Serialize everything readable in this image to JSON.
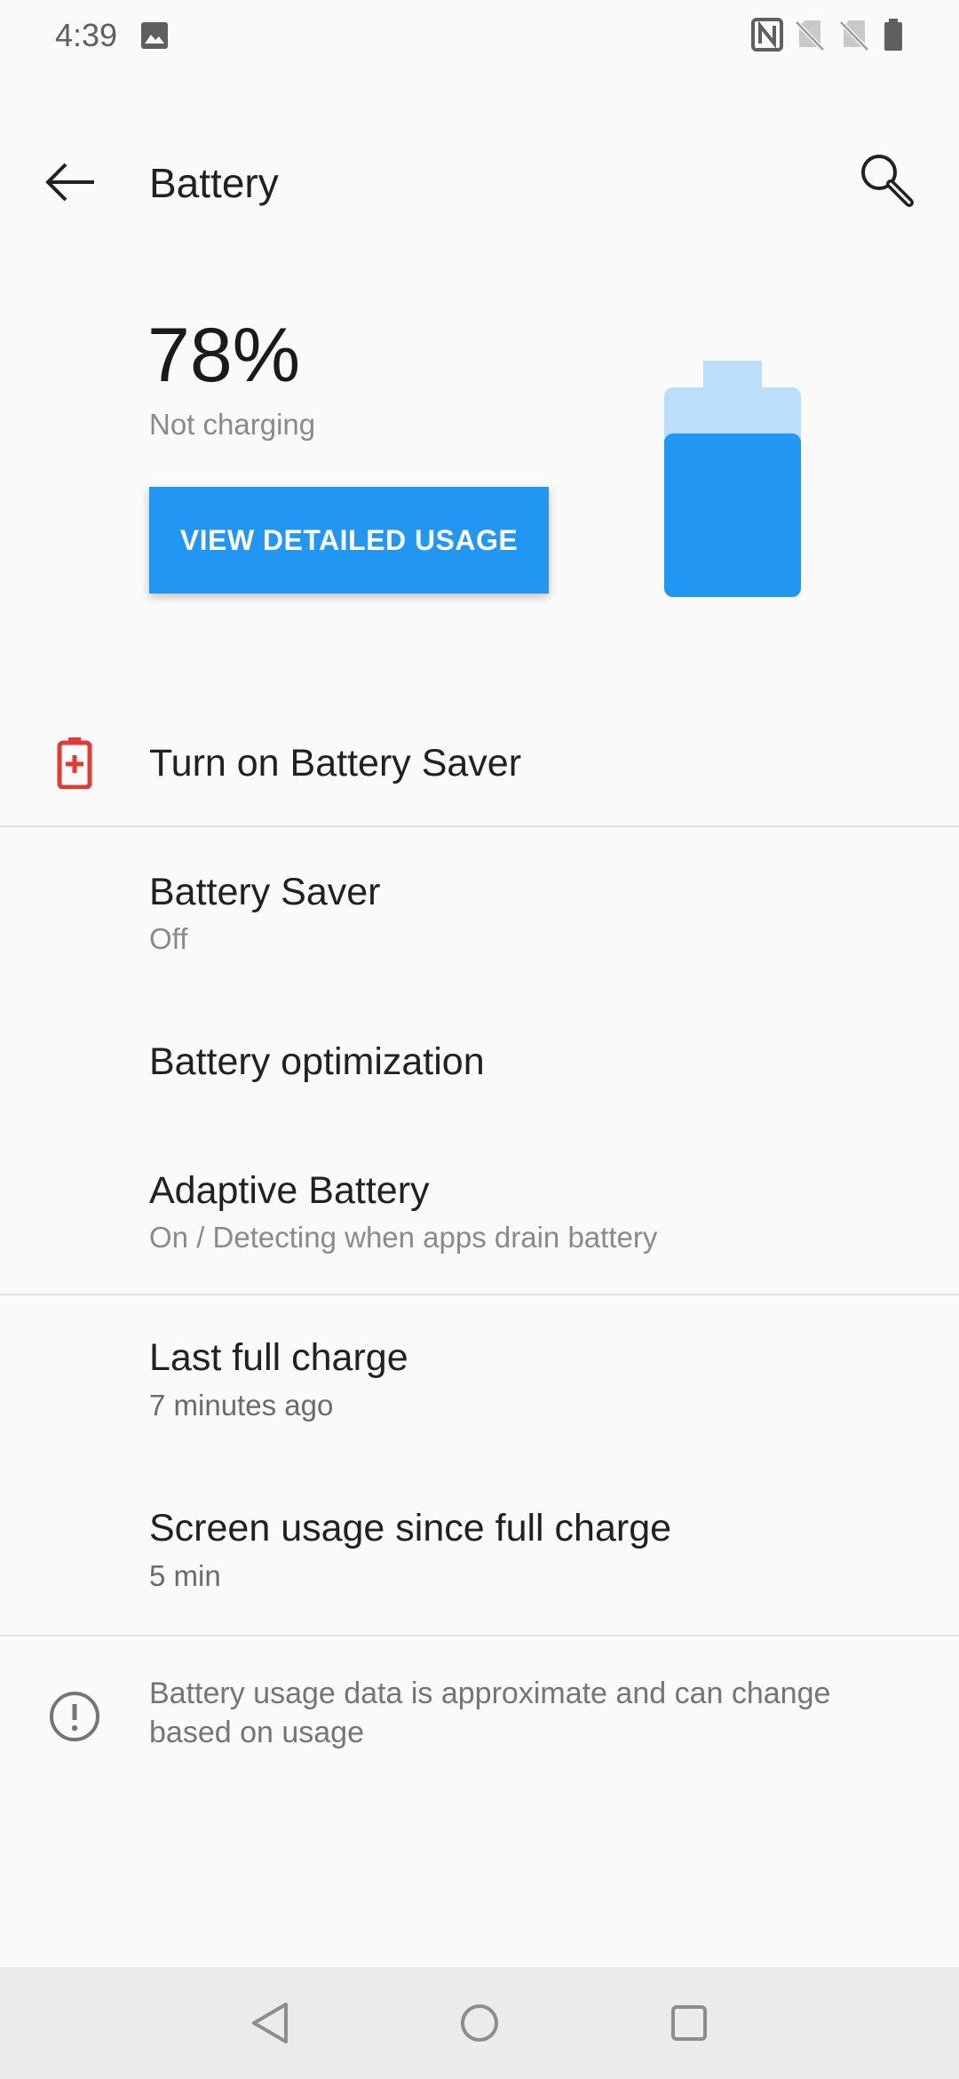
{
  "status_bar": {
    "time": "4:39",
    "icons": [
      "gallery-icon",
      "nfc-icon",
      "sim-off-icon",
      "sim-off-icon",
      "battery-icon"
    ]
  },
  "toolbar": {
    "title": "Battery",
    "back_icon": "back-arrow-icon",
    "search_icon": "search-icon"
  },
  "header": {
    "percent": "78%",
    "level_fraction": 0.78,
    "status": "Not charging",
    "button_label": "VIEW DETAILED USAGE"
  },
  "items": [
    {
      "title": "Turn on Battery Saver",
      "icon": "battery-saver-icon"
    },
    {
      "title": "Battery Saver",
      "subtitle": "Off"
    },
    {
      "title": "Battery optimization"
    },
    {
      "title": "Adaptive Battery",
      "subtitle": "On / Detecting when apps drain battery"
    },
    {
      "title": "Last full charge",
      "subtitle": "7 minutes ago"
    },
    {
      "title": "Screen usage since full charge",
      "subtitle": "5 min"
    }
  ],
  "footer": {
    "info_icon": "info-icon",
    "text": "Battery usage data is approximate and can change based on usage"
  },
  "nav_bar": {
    "icons": [
      "nav-back-icon",
      "nav-home-icon",
      "nav-recents-icon"
    ]
  },
  "colors": {
    "accent": "#2196f3",
    "battery_light": "#bbdefb",
    "saver_red": "#e53935",
    "background": "#fafafa"
  }
}
